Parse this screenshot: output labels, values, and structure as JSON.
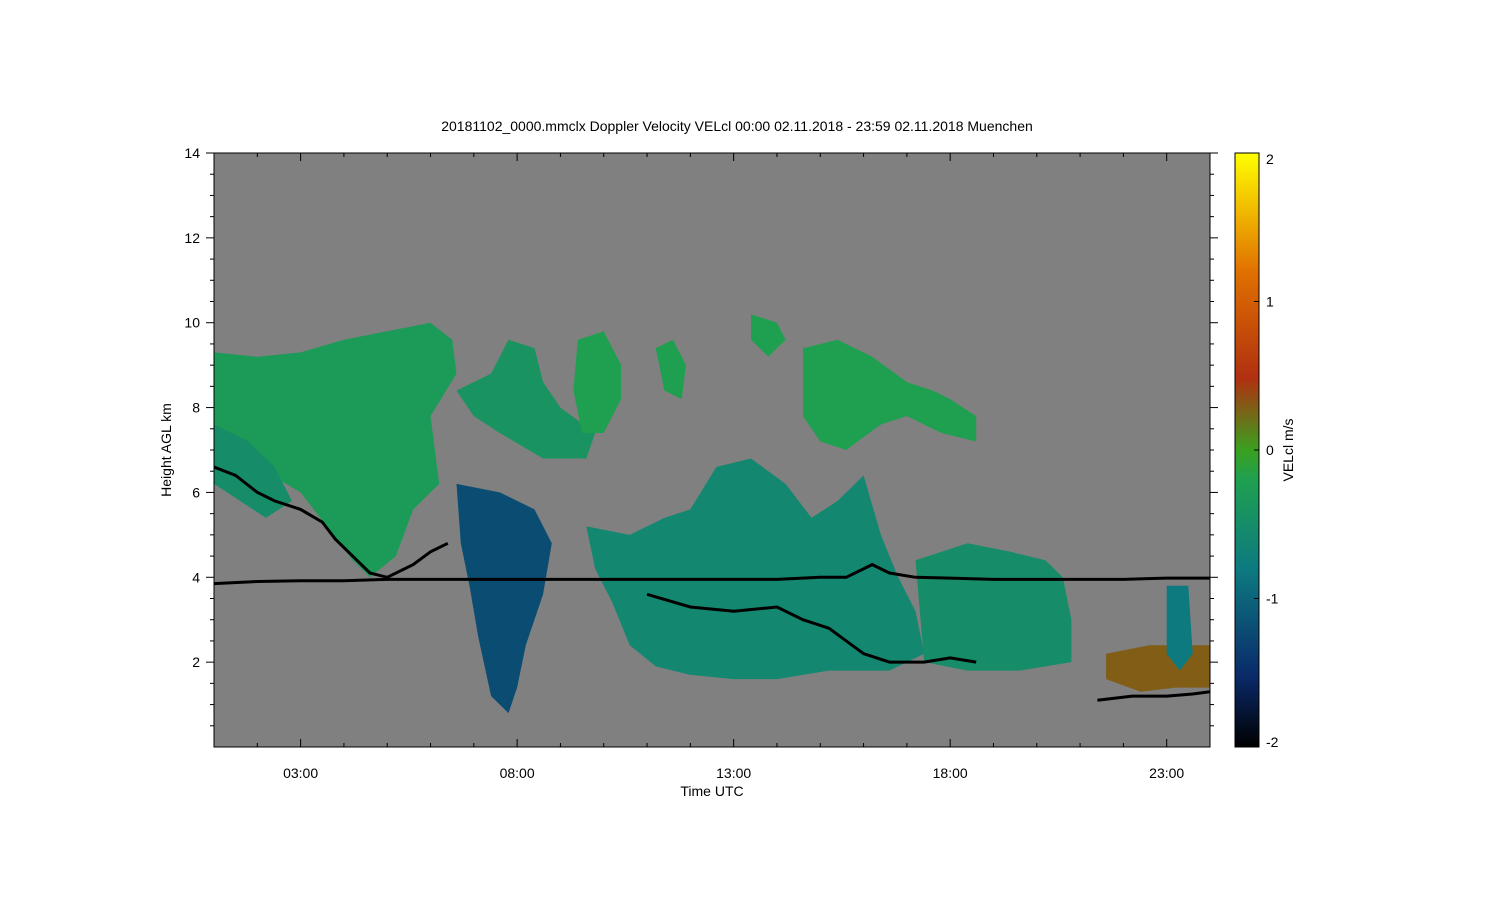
{
  "chart_data": {
    "type": "heatmap",
    "title": "20181102_0000.mmclx Doppler Velocity VELcl   00:00 02.11.2018 - 23:59 02.11.2018 Muenchen",
    "xlabel": "Time UTC",
    "ylabel": "Height AGL km",
    "xlim": [
      1.0,
      24.0
    ],
    "ylim": [
      0.0,
      14.0
    ],
    "x_ticks": [
      {
        "value": 3,
        "label": "03:00"
      },
      {
        "value": 8,
        "label": "08:00"
      },
      {
        "value": 13,
        "label": "13:00"
      },
      {
        "value": 18,
        "label": "18:00"
      },
      {
        "value": 23,
        "label": "23:00"
      }
    ],
    "y_ticks": [
      {
        "value": 2,
        "label": "2"
      },
      {
        "value": 4,
        "label": "4"
      },
      {
        "value": 6,
        "label": "6"
      },
      {
        "value": 8,
        "label": "8"
      },
      {
        "value": 10,
        "label": "10"
      },
      {
        "value": 12,
        "label": "12"
      },
      {
        "value": 14,
        "label": "14"
      }
    ],
    "colorbar": {
      "label": "VELcl m/s",
      "range": [
        -2,
        2
      ],
      "ticks": [
        {
          "value": 2,
          "label": "2"
        },
        {
          "value": 1,
          "label": "1"
        },
        {
          "value": 0,
          "label": "0"
        },
        {
          "value": -1,
          "label": "-1"
        },
        {
          "value": -2,
          "label": "-2"
        }
      ],
      "colors": [
        "#000000",
        "#0a2a6a",
        "#0d7a80",
        "#1fa050",
        "#3aa020",
        "#b03010",
        "#e07000",
        "#ffff00"
      ]
    },
    "background_color": "#808080",
    "regions": [
      {
        "name": "upper-cloud-morning",
        "velocity": -0.3,
        "polygon": [
          [
            1.0,
            9.3
          ],
          [
            2.0,
            9.2
          ],
          [
            3.0,
            9.3
          ],
          [
            4.0,
            9.6
          ],
          [
            5.0,
            9.8
          ],
          [
            6.0,
            10.0
          ],
          [
            6.5,
            9.6
          ],
          [
            6.6,
            8.8
          ],
          [
            6.0,
            7.8
          ],
          [
            6.2,
            6.2
          ],
          [
            5.6,
            5.6
          ],
          [
            5.2,
            4.5
          ],
          [
            4.6,
            4.0
          ],
          [
            4.2,
            4.4
          ],
          [
            3.6,
            5.2
          ],
          [
            3.0,
            6.0
          ],
          [
            2.5,
            6.3
          ],
          [
            2.2,
            6.6
          ],
          [
            1.6,
            7.1
          ],
          [
            1.0,
            7.6
          ]
        ]
      },
      {
        "name": "upper-cloud-morning-lower-edge",
        "velocity": -0.5,
        "polygon": [
          [
            1.0,
            7.6
          ],
          [
            1.8,
            7.2
          ],
          [
            2.4,
            6.6
          ],
          [
            2.8,
            5.8
          ],
          [
            2.2,
            5.4
          ],
          [
            1.6,
            5.8
          ],
          [
            1.0,
            6.2
          ]
        ]
      },
      {
        "name": "deep-downdraft-08",
        "velocity": -1.2,
        "polygon": [
          [
            6.6,
            6.2
          ],
          [
            7.6,
            6.0
          ],
          [
            8.4,
            5.6
          ],
          [
            8.8,
            4.8
          ],
          [
            8.6,
            3.6
          ],
          [
            8.2,
            2.4
          ],
          [
            8.0,
            1.4
          ],
          [
            7.8,
            0.8
          ],
          [
            7.4,
            1.2
          ],
          [
            7.1,
            2.6
          ],
          [
            6.9,
            3.8
          ],
          [
            6.7,
            4.8
          ]
        ]
      },
      {
        "name": "mid-cloud-0800",
        "velocity": -0.4,
        "polygon": [
          [
            6.6,
            8.4
          ],
          [
            7.4,
            8.8
          ],
          [
            7.8,
            9.6
          ],
          [
            8.4,
            9.4
          ],
          [
            8.6,
            8.6
          ],
          [
            9.0,
            8.0
          ],
          [
            9.8,
            7.4
          ],
          [
            9.6,
            6.8
          ],
          [
            8.6,
            6.8
          ],
          [
            7.6,
            7.4
          ],
          [
            7.0,
            7.8
          ]
        ]
      },
      {
        "name": "cloud-1000",
        "velocity": -0.2,
        "polygon": [
          [
            9.4,
            9.6
          ],
          [
            10.0,
            9.8
          ],
          [
            10.4,
            9.0
          ],
          [
            10.4,
            8.2
          ],
          [
            10.0,
            7.4
          ],
          [
            9.5,
            7.4
          ],
          [
            9.3,
            8.4
          ]
        ]
      },
      {
        "name": "cloud-1100",
        "velocity": -0.2,
        "polygon": [
          [
            11.2,
            9.4
          ],
          [
            11.6,
            9.6
          ],
          [
            11.9,
            9.0
          ],
          [
            11.8,
            8.2
          ],
          [
            11.4,
            8.4
          ]
        ]
      },
      {
        "name": "mid-cloud-noon",
        "velocity": -0.6,
        "polygon": [
          [
            9.6,
            5.2
          ],
          [
            10.6,
            5.0
          ],
          [
            11.4,
            5.4
          ],
          [
            12.0,
            5.6
          ],
          [
            12.6,
            6.6
          ],
          [
            13.4,
            6.8
          ],
          [
            14.2,
            6.2
          ],
          [
            14.8,
            5.4
          ],
          [
            15.4,
            5.8
          ],
          [
            16.0,
            6.4
          ],
          [
            16.4,
            5.0
          ],
          [
            16.8,
            4.0
          ],
          [
            17.2,
            3.2
          ],
          [
            17.4,
            2.2
          ],
          [
            16.6,
            1.8
          ],
          [
            15.2,
            1.8
          ],
          [
            14.0,
            1.6
          ],
          [
            13.0,
            1.6
          ],
          [
            12.0,
            1.7
          ],
          [
            11.2,
            1.9
          ],
          [
            10.6,
            2.4
          ],
          [
            10.2,
            3.4
          ],
          [
            9.8,
            4.2
          ]
        ]
      },
      {
        "name": "upper-cloud-afternoon",
        "velocity": -0.2,
        "polygon": [
          [
            14.6,
            9.4
          ],
          [
            15.4,
            9.6
          ],
          [
            16.2,
            9.2
          ],
          [
            17.0,
            8.6
          ],
          [
            17.6,
            8.4
          ],
          [
            18.0,
            8.2
          ],
          [
            18.6,
            7.8
          ],
          [
            18.6,
            7.2
          ],
          [
            17.8,
            7.4
          ],
          [
            17.0,
            7.8
          ],
          [
            16.4,
            7.6
          ],
          [
            15.6,
            7.0
          ],
          [
            15.0,
            7.2
          ],
          [
            14.6,
            7.8
          ]
        ]
      },
      {
        "name": "cloud-14",
        "velocity": -0.2,
        "polygon": [
          [
            13.4,
            10.2
          ],
          [
            14.0,
            10.0
          ],
          [
            14.2,
            9.6
          ],
          [
            13.8,
            9.2
          ],
          [
            13.4,
            9.6
          ]
        ]
      },
      {
        "name": "afternoon-lower-cloud",
        "velocity": -0.5,
        "polygon": [
          [
            17.2,
            4.4
          ],
          [
            18.4,
            4.8
          ],
          [
            19.4,
            4.6
          ],
          [
            20.2,
            4.4
          ],
          [
            20.6,
            4.0
          ],
          [
            20.8,
            3.0
          ],
          [
            20.8,
            2.0
          ],
          [
            19.6,
            1.8
          ],
          [
            18.4,
            1.8
          ],
          [
            17.4,
            2.0
          ]
        ]
      },
      {
        "name": "low-cloud-evening",
        "velocity": 0.3,
        "polygon": [
          [
            21.6,
            2.2
          ],
          [
            22.6,
            2.4
          ],
          [
            23.4,
            2.4
          ],
          [
            24.0,
            2.4
          ],
          [
            24.0,
            1.4
          ],
          [
            23.2,
            1.4
          ],
          [
            22.4,
            1.3
          ],
          [
            21.6,
            1.6
          ]
        ]
      },
      {
        "name": "small-cloud-23",
        "velocity": -0.8,
        "polygon": [
          [
            23.0,
            3.8
          ],
          [
            23.5,
            3.8
          ],
          [
            23.6,
            2.2
          ],
          [
            23.3,
            1.8
          ],
          [
            23.0,
            2.2
          ]
        ]
      }
    ],
    "lines": [
      {
        "name": "melting-layer",
        "color": "#000000",
        "points": [
          [
            1.0,
            3.85
          ],
          [
            2.0,
            3.9
          ],
          [
            3.0,
            3.92
          ],
          [
            4.0,
            3.92
          ],
          [
            5.0,
            3.95
          ],
          [
            6.0,
            3.95
          ],
          [
            7.0,
            3.95
          ],
          [
            8.0,
            3.95
          ],
          [
            9.0,
            3.95
          ],
          [
            10.0,
            3.95
          ],
          [
            11.0,
            3.95
          ],
          [
            12.0,
            3.95
          ],
          [
            13.0,
            3.95
          ],
          [
            14.0,
            3.95
          ],
          [
            15.0,
            4.0
          ],
          [
            15.6,
            4.0
          ],
          [
            16.2,
            4.3
          ],
          [
            16.6,
            4.1
          ],
          [
            17.2,
            4.0
          ],
          [
            18.0,
            3.98
          ],
          [
            19.0,
            3.95
          ],
          [
            20.0,
            3.95
          ],
          [
            21.0,
            3.95
          ],
          [
            22.0,
            3.95
          ],
          [
            23.0,
            3.98
          ],
          [
            24.0,
            3.98
          ]
        ]
      },
      {
        "name": "cloud-base-morning",
        "color": "#000000",
        "points": [
          [
            1.0,
            6.6
          ],
          [
            1.5,
            6.4
          ],
          [
            2.0,
            6.0
          ],
          [
            2.4,
            5.8
          ],
          [
            3.0,
            5.6
          ],
          [
            3.5,
            5.3
          ],
          [
            3.8,
            4.9
          ],
          [
            4.2,
            4.5
          ],
          [
            4.6,
            4.1
          ],
          [
            5.0,
            4.0
          ],
          [
            5.6,
            4.3
          ],
          [
            6.0,
            4.6
          ],
          [
            6.4,
            4.8
          ]
        ]
      },
      {
        "name": "cloud-base-midday",
        "color": "#000000",
        "points": [
          [
            11.0,
            3.6
          ],
          [
            12.0,
            3.3
          ],
          [
            13.0,
            3.2
          ],
          [
            14.0,
            3.3
          ],
          [
            14.6,
            3.0
          ],
          [
            15.2,
            2.8
          ],
          [
            16.0,
            2.2
          ],
          [
            16.6,
            2.0
          ],
          [
            17.4,
            2.0
          ],
          [
            18.0,
            2.1
          ],
          [
            18.6,
            2.0
          ]
        ]
      },
      {
        "name": "cloud-base-evening",
        "color": "#000000",
        "points": [
          [
            21.4,
            1.1
          ],
          [
            22.2,
            1.2
          ],
          [
            23.0,
            1.2
          ],
          [
            23.6,
            1.25
          ],
          [
            24.0,
            1.3
          ]
        ]
      }
    ]
  }
}
